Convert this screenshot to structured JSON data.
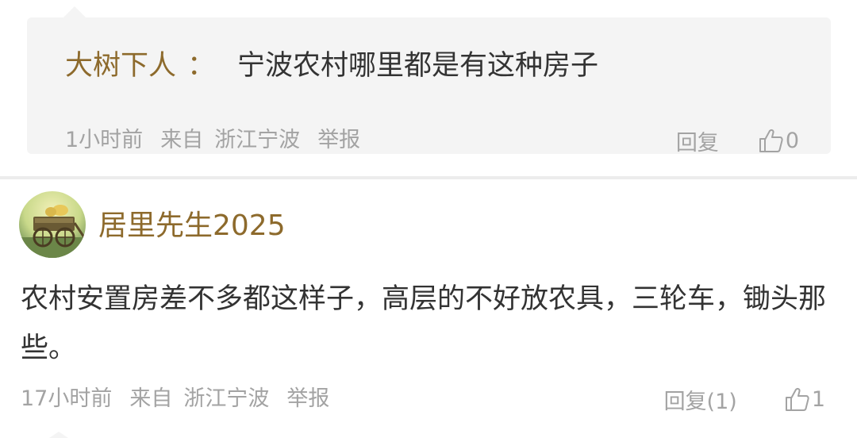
{
  "quoted_reply": {
    "author": "大树下人",
    "colon": "：",
    "text": "宁波农村哪里都是有这种房子",
    "time": "1小时前",
    "source_prefix": "来自",
    "location": "浙江宁波",
    "report_label": "举报",
    "reply_label": "回复",
    "like_count": "0"
  },
  "comment": {
    "username": "居里先生2025",
    "avatar_icon": "cart-avatar",
    "text": "农村安置房差不多都这样子，高层的不好放农具，三轮车，锄头那些。",
    "time": "17小时前",
    "source_prefix": "来自",
    "location": "浙江宁波",
    "report_label": "举报",
    "reply_label": "回复(1)",
    "like_count": "1"
  },
  "colors": {
    "author": "#8d6a2c",
    "body_text": "#333333",
    "meta_text": "#a3a3a3",
    "reply_box_bg": "#f4f4f4"
  }
}
